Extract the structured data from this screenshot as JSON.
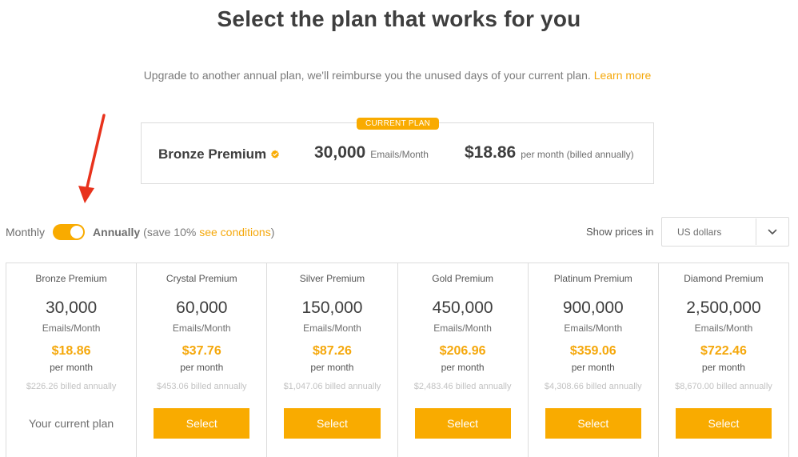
{
  "header": {
    "title": "Select the plan that works for you",
    "subtitle": "Upgrade to another annual plan, we'll reimburse you the unused days of your current plan.",
    "learn_more": "Learn more"
  },
  "current_plan": {
    "badge": "CURRENT PLAN",
    "name": "Bronze Premium",
    "emails": "30,000",
    "emails_label": "Emails/Month",
    "price": "$18.86",
    "price_label": "per month (billed annually)"
  },
  "billing": {
    "monthly_label": "Monthly",
    "annually_label": "Annually",
    "save_prefix": "(save 10%",
    "conditions_link": "see conditions",
    "save_suffix": ")",
    "toggle_state": "annually"
  },
  "currency": {
    "label": "Show prices in",
    "selected": "US dollars"
  },
  "colors": {
    "accent": "#f9ab00",
    "link": "#f5a80c",
    "arrow": "#e8321c"
  },
  "plans": [
    {
      "name": "Bronze Premium",
      "emails": "30,000",
      "emails_label": "Emails/Month",
      "price": "$18.86",
      "per": "per month",
      "billed": "$226.26 billed annually",
      "action": "Your current plan",
      "is_current": true
    },
    {
      "name": "Crystal Premium",
      "emails": "60,000",
      "emails_label": "Emails/Month",
      "price": "$37.76",
      "per": "per month",
      "billed": "$453.06 billed annually",
      "action": "Select",
      "is_current": false
    },
    {
      "name": "Silver Premium",
      "emails": "150,000",
      "emails_label": "Emails/Month",
      "price": "$87.26",
      "per": "per month",
      "billed": "$1,047.06 billed annually",
      "action": "Select",
      "is_current": false
    },
    {
      "name": "Gold Premium",
      "emails": "450,000",
      "emails_label": "Emails/Month",
      "price": "$206.96",
      "per": "per month",
      "billed": "$2,483.46 billed annually",
      "action": "Select",
      "is_current": false
    },
    {
      "name": "Platinum Premium",
      "emails": "900,000",
      "emails_label": "Emails/Month",
      "price": "$359.06",
      "per": "per month",
      "billed": "$4,308.66 billed annually",
      "action": "Select",
      "is_current": false
    },
    {
      "name": "Diamond Premium",
      "emails": "2,500,000",
      "emails_label": "Emails/Month",
      "price": "$722.46",
      "per": "per month",
      "billed": "$8,670.00 billed annually",
      "action": "Select",
      "is_current": false
    }
  ]
}
